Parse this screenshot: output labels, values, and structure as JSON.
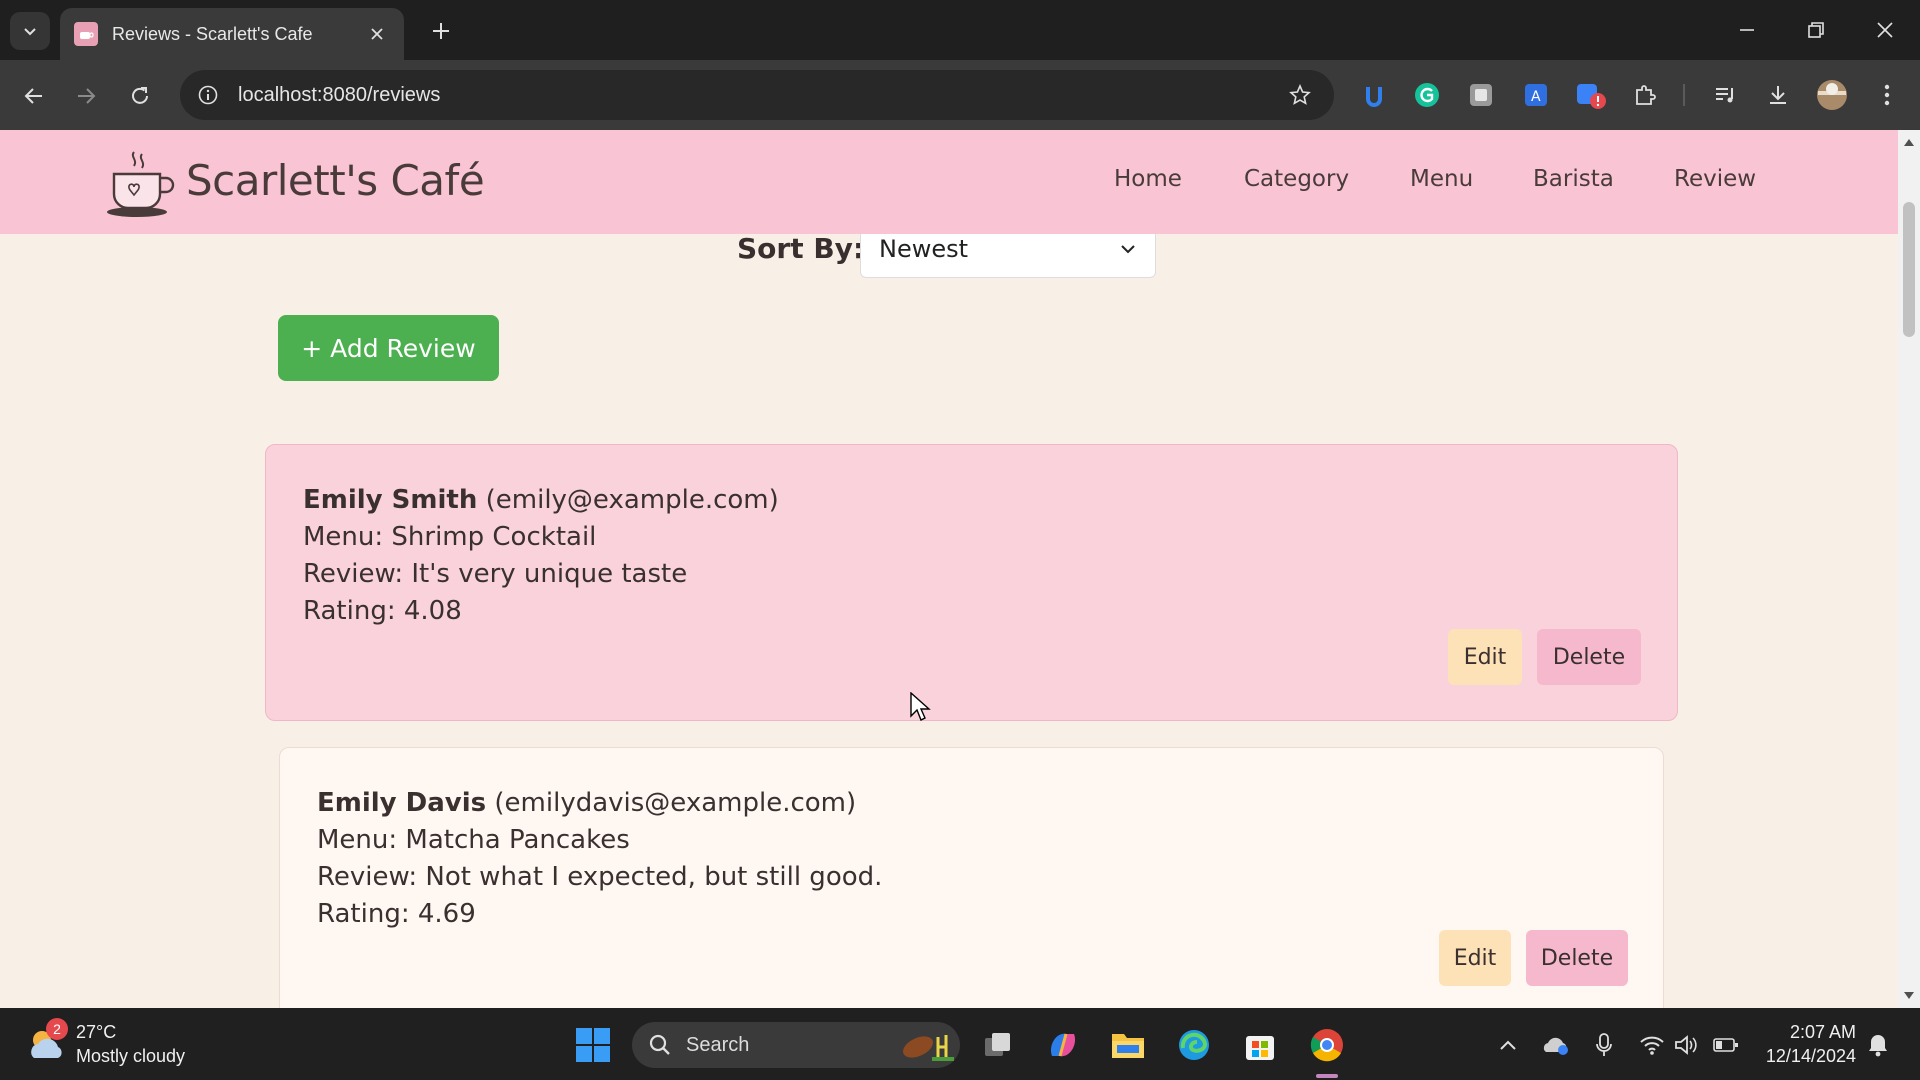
{
  "browser": {
    "tab_title": "Reviews - Scarlett's Cafe",
    "url": "localhost:8080/reviews"
  },
  "site": {
    "brand": "Scarlett's Café",
    "nav": [
      {
        "label": "Home"
      },
      {
        "label": "Category"
      },
      {
        "label": "Menu"
      },
      {
        "label": "Barista"
      },
      {
        "label": "Review"
      }
    ]
  },
  "controls": {
    "sort_label": "Sort By:",
    "sort_value": "Newest",
    "add_review_label": "+ Add Review"
  },
  "reviews": [
    {
      "name": "Emily Smith",
      "email": "(emily@example.com)",
      "menu_line": "Menu: Shrimp Cocktail",
      "review_line": "Review: It's very unique taste",
      "rating_line": "Rating: 4.08",
      "edit_label": "Edit",
      "delete_label": "Delete"
    },
    {
      "name": "Emily Davis",
      "email": "(emilydavis@example.com)",
      "menu_line": "Menu: Matcha Pancakes",
      "review_line": "Review: Not what I expected, but still good.",
      "rating_line": "Rating: 4.69",
      "edit_label": "Edit",
      "delete_label": "Delete"
    }
  ],
  "taskbar": {
    "weather_badge": "2",
    "temperature": "27°C",
    "weather": "Mostly cloudy",
    "search_label": "Search",
    "time": "2:07 AM",
    "date": "12/14/2024"
  },
  "colors": {
    "nav_bg": "#f9c4d4",
    "page_bg": "#f8f0e6",
    "add_button": "#4caf50",
    "edit_button": "#fde2b8",
    "delete_button": "#f6b8cc",
    "highlight_card": "#f9d2db"
  }
}
